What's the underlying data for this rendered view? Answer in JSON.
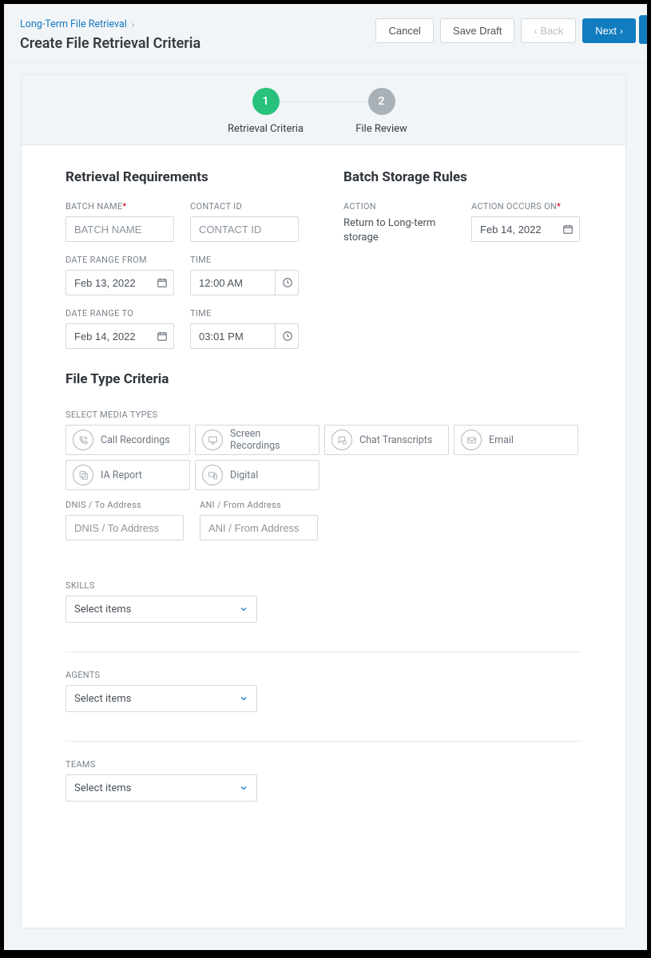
{
  "breadcrumb": {
    "parent": "Long-Term File Retrieval"
  },
  "pageTitle": "Create File Retrieval Criteria",
  "actions": {
    "cancel": "Cancel",
    "saveDraft": "Save Draft",
    "back": "Back",
    "next": "Next"
  },
  "steps": [
    {
      "num": "1",
      "label": "Retrieval Criteria",
      "active": true
    },
    {
      "num": "2",
      "label": "File Review",
      "active": false
    }
  ],
  "sections": {
    "retrievalReq": {
      "heading": "Retrieval Requirements",
      "batchName": {
        "label": "BATCH NAME",
        "placeholder": "BATCH NAME",
        "value": "",
        "required": true
      },
      "contactId": {
        "label": "CONTACT ID",
        "placeholder": "CONTACT ID",
        "value": ""
      },
      "dateFrom": {
        "label": "DATE RANGE FROM",
        "value": "Feb 13, 2022"
      },
      "timeFrom": {
        "label": "TIME",
        "value": "12:00 AM"
      },
      "dateTo": {
        "label": "DATE RANGE TO",
        "value": "Feb 14, 2022"
      },
      "timeTo": {
        "label": "TIME",
        "value": "03:01 PM"
      }
    },
    "batchRules": {
      "heading": "Batch Storage Rules",
      "actionLabel": "ACTION",
      "actionValue": "Return to Long-term storage",
      "occursLabel": "ACTION OCCURS ON",
      "occursValue": "Feb 14, 2022",
      "occursRequired": true
    },
    "fileType": {
      "heading": "File Type Criteria",
      "mediaLabel": "SELECT MEDIA TYPES",
      "mediaTypes": [
        {
          "id": "call-recordings",
          "label": "Call Recordings"
        },
        {
          "id": "screen-recordings",
          "label": "Screen Recordings"
        },
        {
          "id": "chat-transcripts",
          "label": "Chat Transcripts"
        },
        {
          "id": "email",
          "label": "Email"
        },
        {
          "id": "ia-report",
          "label": "IA Report"
        },
        {
          "id": "digital",
          "label": "Digital"
        }
      ],
      "dnis": {
        "label": "DNIS / To Address",
        "placeholder": "DNIS / To Address",
        "value": ""
      },
      "ani": {
        "label": "ANI / From Address",
        "placeholder": "ANI / From Address",
        "value": ""
      }
    },
    "skills": {
      "label": "SKILLS",
      "placeholder": "Select items"
    },
    "agents": {
      "label": "AGENTS",
      "placeholder": "Select items"
    },
    "teams": {
      "label": "TEAMS",
      "placeholder": "Select items"
    }
  }
}
